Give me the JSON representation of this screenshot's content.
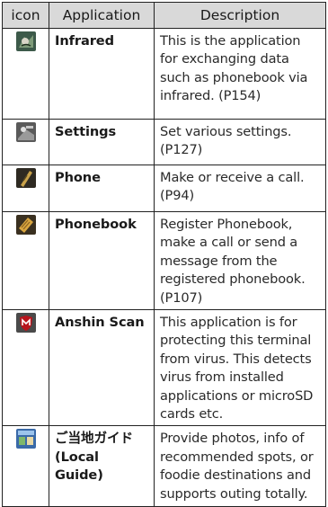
{
  "table": {
    "headers": {
      "icon": "icon",
      "application": "Application",
      "description": "Description"
    },
    "rows": [
      {
        "icon": "infrared-icon",
        "application": "Infrared",
        "description": "This is the application for exchanging data such as phonebook via infrared. (P154)"
      },
      {
        "icon": "settings-icon",
        "application": "Settings",
        "description": "Set various settings. (P127)"
      },
      {
        "icon": "phone-icon",
        "application": "Phone",
        "description": "Make or receive a call. (P94)"
      },
      {
        "icon": "phonebook-icon",
        "application": "Phonebook",
        "description": "Register Phonebook, make a call or send a message from the registered phonebook. (P107)"
      },
      {
        "icon": "anshin-scan-icon",
        "application": "Anshin Scan",
        "description": "This application is for protecting this terminal from virus. This detects virus from installed applications or microSD cards etc."
      },
      {
        "icon": "local-guide-icon",
        "application": "ご当地ガイド (Local Guide)",
        "description": "Provide photos, info of recommended spots, or foodie destinations and supports outing totally."
      }
    ]
  }
}
